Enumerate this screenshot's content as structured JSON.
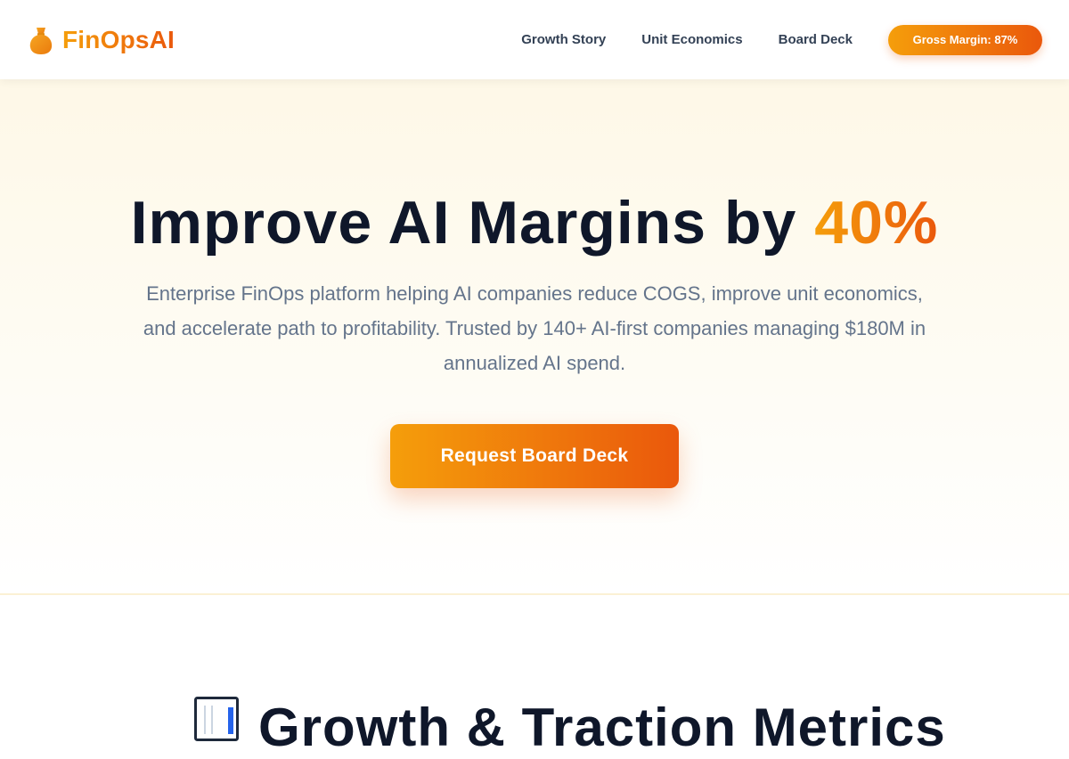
{
  "brand": {
    "name": "FinOpsAI",
    "icon": "money-bag-icon"
  },
  "nav": {
    "links": [
      "Growth Story",
      "Unit Economics",
      "Board Deck"
    ],
    "badge": "Gross Margin: 87%"
  },
  "hero": {
    "title_prefix": "Improve AI Margins by ",
    "title_highlight": "40%",
    "subtitle": "Enterprise FinOps platform helping AI companies reduce COGS, improve unit economics, and accelerate path to profitability. Trusted by 140+ AI-first companies managing $180M in annualized AI spend.",
    "cta_label": "Request Board Deck"
  },
  "metrics_section": {
    "icon": "bar-chart-icon",
    "title": "Growth & Traction Metrics"
  },
  "colors": {
    "accent_start": "#f59e0b",
    "accent_end": "#ea580c",
    "heading": "#0f172a",
    "body_text": "#64748b"
  }
}
